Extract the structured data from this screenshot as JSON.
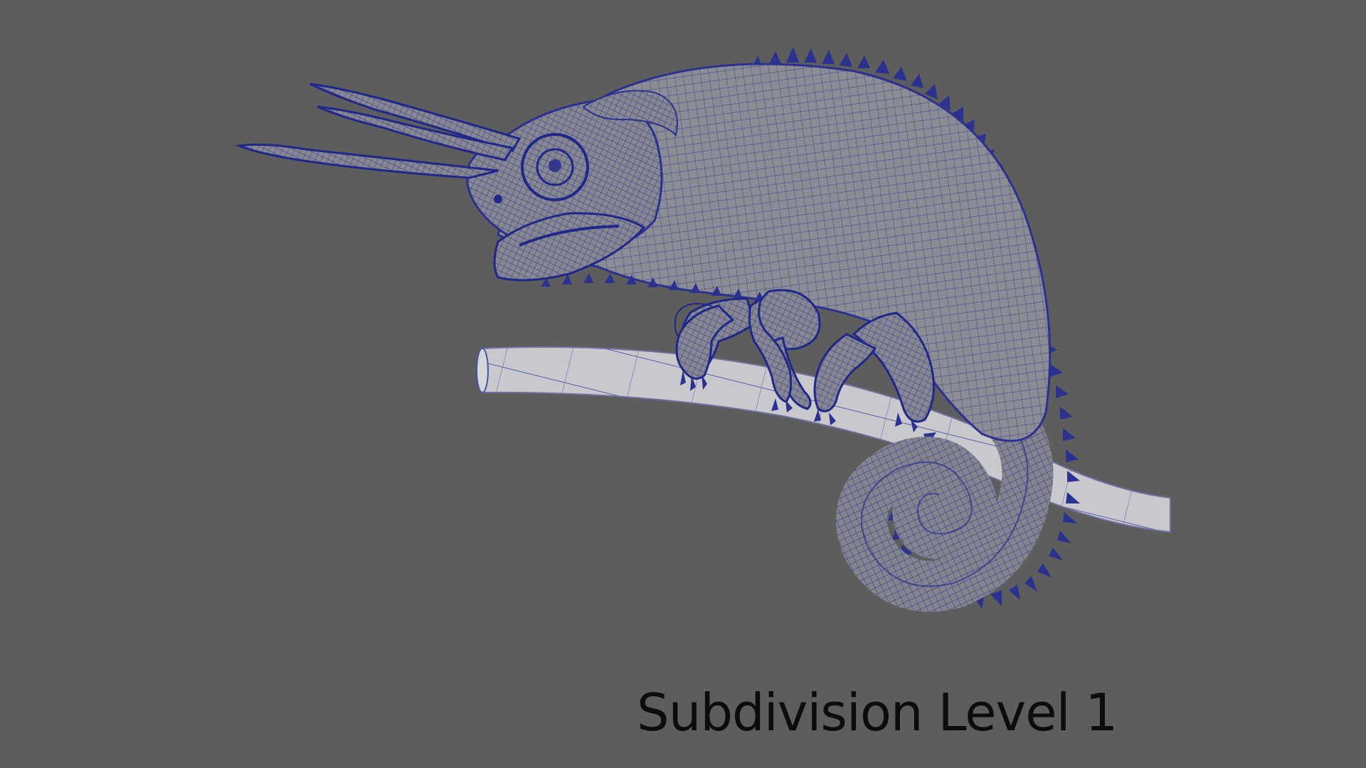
{
  "caption": "Subdivision Level 1",
  "colors": {
    "background": "#5d5d5d",
    "mesh_fill": "#8e8e96",
    "wire": "#232b8e",
    "branch_fill": "#c9c9cf",
    "caption_text": "#0c0c0c"
  },
  "model": {
    "subject": "chameleon-icon",
    "prop": "branch-icon",
    "display": "wireframe-on-shaded"
  }
}
